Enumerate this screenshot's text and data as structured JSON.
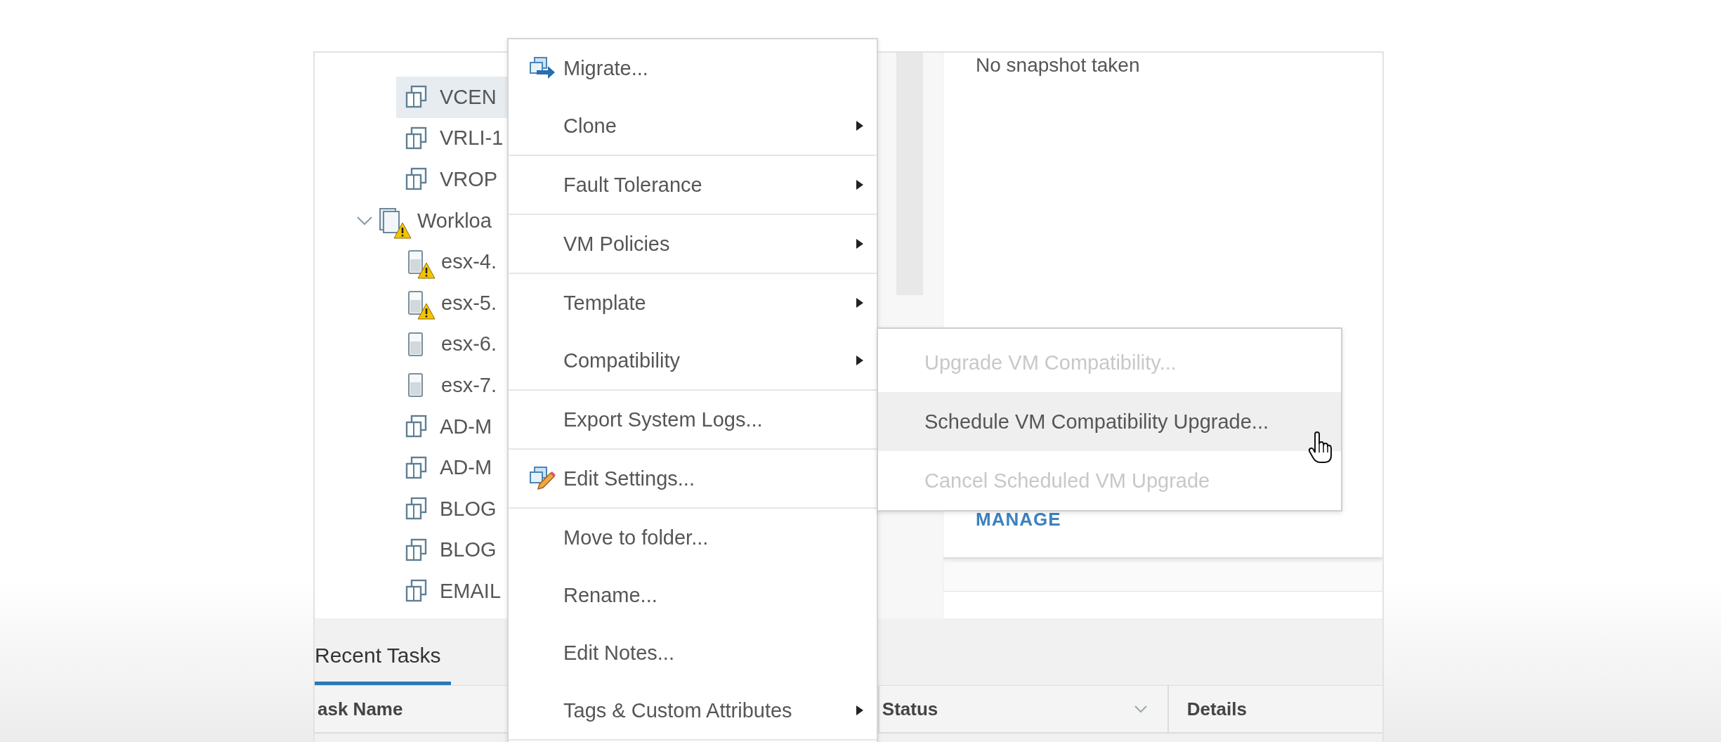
{
  "tree": {
    "items": [
      {
        "label": "VCEN",
        "kind": "vm",
        "selected": true,
        "warning": false
      },
      {
        "label": "VRLI-1",
        "kind": "vm",
        "selected": false,
        "warning": false
      },
      {
        "label": "VROP",
        "kind": "vm",
        "selected": false,
        "warning": false
      },
      {
        "label": "Workloa",
        "kind": "cluster",
        "selected": false,
        "warning": true,
        "expanded": true,
        "children": [
          {
            "label": "esx-4.",
            "kind": "host",
            "selected": false,
            "warning": true
          },
          {
            "label": "esx-5.",
            "kind": "host",
            "selected": false,
            "warning": true
          },
          {
            "label": "esx-6.",
            "kind": "host",
            "selected": false,
            "warning": false
          },
          {
            "label": "esx-7.",
            "kind": "host",
            "selected": false,
            "warning": false
          },
          {
            "label": "AD-M",
            "kind": "vm",
            "selected": false,
            "warning": false
          },
          {
            "label": "AD-M",
            "kind": "vm",
            "selected": false,
            "warning": false
          },
          {
            "label": "BLOG",
            "kind": "vm",
            "selected": false,
            "warning": false
          },
          {
            "label": "BLOG",
            "kind": "vm",
            "selected": false,
            "warning": false
          },
          {
            "label": "EMAIL",
            "kind": "vm",
            "selected": false,
            "warning": false
          }
        ]
      }
    ]
  },
  "context_menu": {
    "groups": [
      [
        {
          "label": "Migrate...",
          "kind": "migrate",
          "submenu": false
        },
        {
          "label": "Clone",
          "kind": "plain",
          "submenu": true
        }
      ],
      [
        {
          "label": "Fault Tolerance",
          "kind": "plain",
          "submenu": true
        }
      ],
      [
        {
          "label": "VM Policies",
          "kind": "plain",
          "submenu": true
        }
      ],
      [
        {
          "label": "Template",
          "kind": "plain",
          "submenu": true
        },
        {
          "label": "Compatibility",
          "kind": "plain",
          "submenu": true
        }
      ],
      [
        {
          "label": "Export System Logs...",
          "kind": "plain",
          "submenu": false
        }
      ],
      [
        {
          "label": "Edit Settings...",
          "kind": "settings",
          "submenu": false
        }
      ],
      [
        {
          "label": "Move to folder...",
          "kind": "plain",
          "submenu": false
        },
        {
          "label": "Rename...",
          "kind": "plain",
          "submenu": false
        },
        {
          "label": "Edit Notes...",
          "kind": "plain",
          "submenu": false
        },
        {
          "label": "Tags & Custom Attributes",
          "kind": "plain",
          "submenu": true
        }
      ]
    ]
  },
  "submenu": {
    "items": [
      {
        "label": "Upgrade VM Compatibility...",
        "disabled": true,
        "selected": false
      },
      {
        "label": "Schedule VM Compatibility Upgrade...",
        "disabled": false,
        "selected": true
      },
      {
        "label": "Cancel Scheduled VM Upgrade",
        "disabled": true,
        "selected": false
      }
    ]
  },
  "snapshots": {
    "text": "No snapshot taken",
    "link": "MANAGE"
  },
  "recent_tasks": {
    "tabs": [
      {
        "label": "Recent Tasks",
        "selected": true
      }
    ],
    "columns": [
      {
        "label": "ask Name",
        "filter": false
      },
      {
        "label": "Status",
        "filter": true
      },
      {
        "label": "Details",
        "filter": false
      }
    ]
  }
}
